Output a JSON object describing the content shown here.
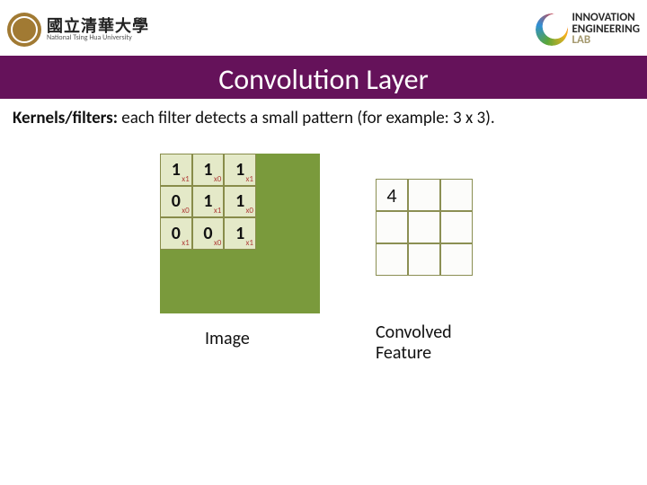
{
  "header": {
    "nthu_cn": "國立清華大學",
    "nthu_en": "National Tsing Hua University",
    "iel_line1": "INNOVATION",
    "iel_line2": "ENGINEERING",
    "iel_line3": "LAB"
  },
  "title": "Convolution Layer",
  "description": {
    "bold": "Kernels/filters:",
    "rest": " each filter detects a small pattern (for example: 3 x 3)."
  },
  "image": {
    "grid_size": 5,
    "kernel": {
      "values": [
        {
          "v": "1",
          "sub": "x1"
        },
        {
          "v": "1",
          "sub": "x0"
        },
        {
          "v": "1",
          "sub": "x1"
        },
        {
          "v": "0",
          "sub": "x0"
        },
        {
          "v": "1",
          "sub": "x1"
        },
        {
          "v": "1",
          "sub": "x0"
        },
        {
          "v": "0",
          "sub": "x1"
        },
        {
          "v": "0",
          "sub": "x0"
        },
        {
          "v": "1",
          "sub": "x1"
        }
      ]
    },
    "label": "Image"
  },
  "feature": {
    "values": [
      "4",
      "",
      "",
      "",
      "",
      "",
      "",
      "",
      ""
    ],
    "label_line1": "Convolved",
    "label_line2": "Feature"
  },
  "chart_data": {
    "type": "table",
    "title": "Convolution kernel applied to image region",
    "kernel_position": [
      0,
      0
    ],
    "image_patch": [
      [
        1,
        1,
        1
      ],
      [
        0,
        1,
        1
      ],
      [
        0,
        0,
        1
      ]
    ],
    "filter_weights": [
      [
        1,
        0,
        1
      ],
      [
        0,
        1,
        0
      ],
      [
        1,
        0,
        1
      ]
    ],
    "convolved_feature": [
      [
        4,
        null,
        null
      ],
      [
        null,
        null,
        null
      ],
      [
        null,
        null,
        null
      ]
    ]
  }
}
